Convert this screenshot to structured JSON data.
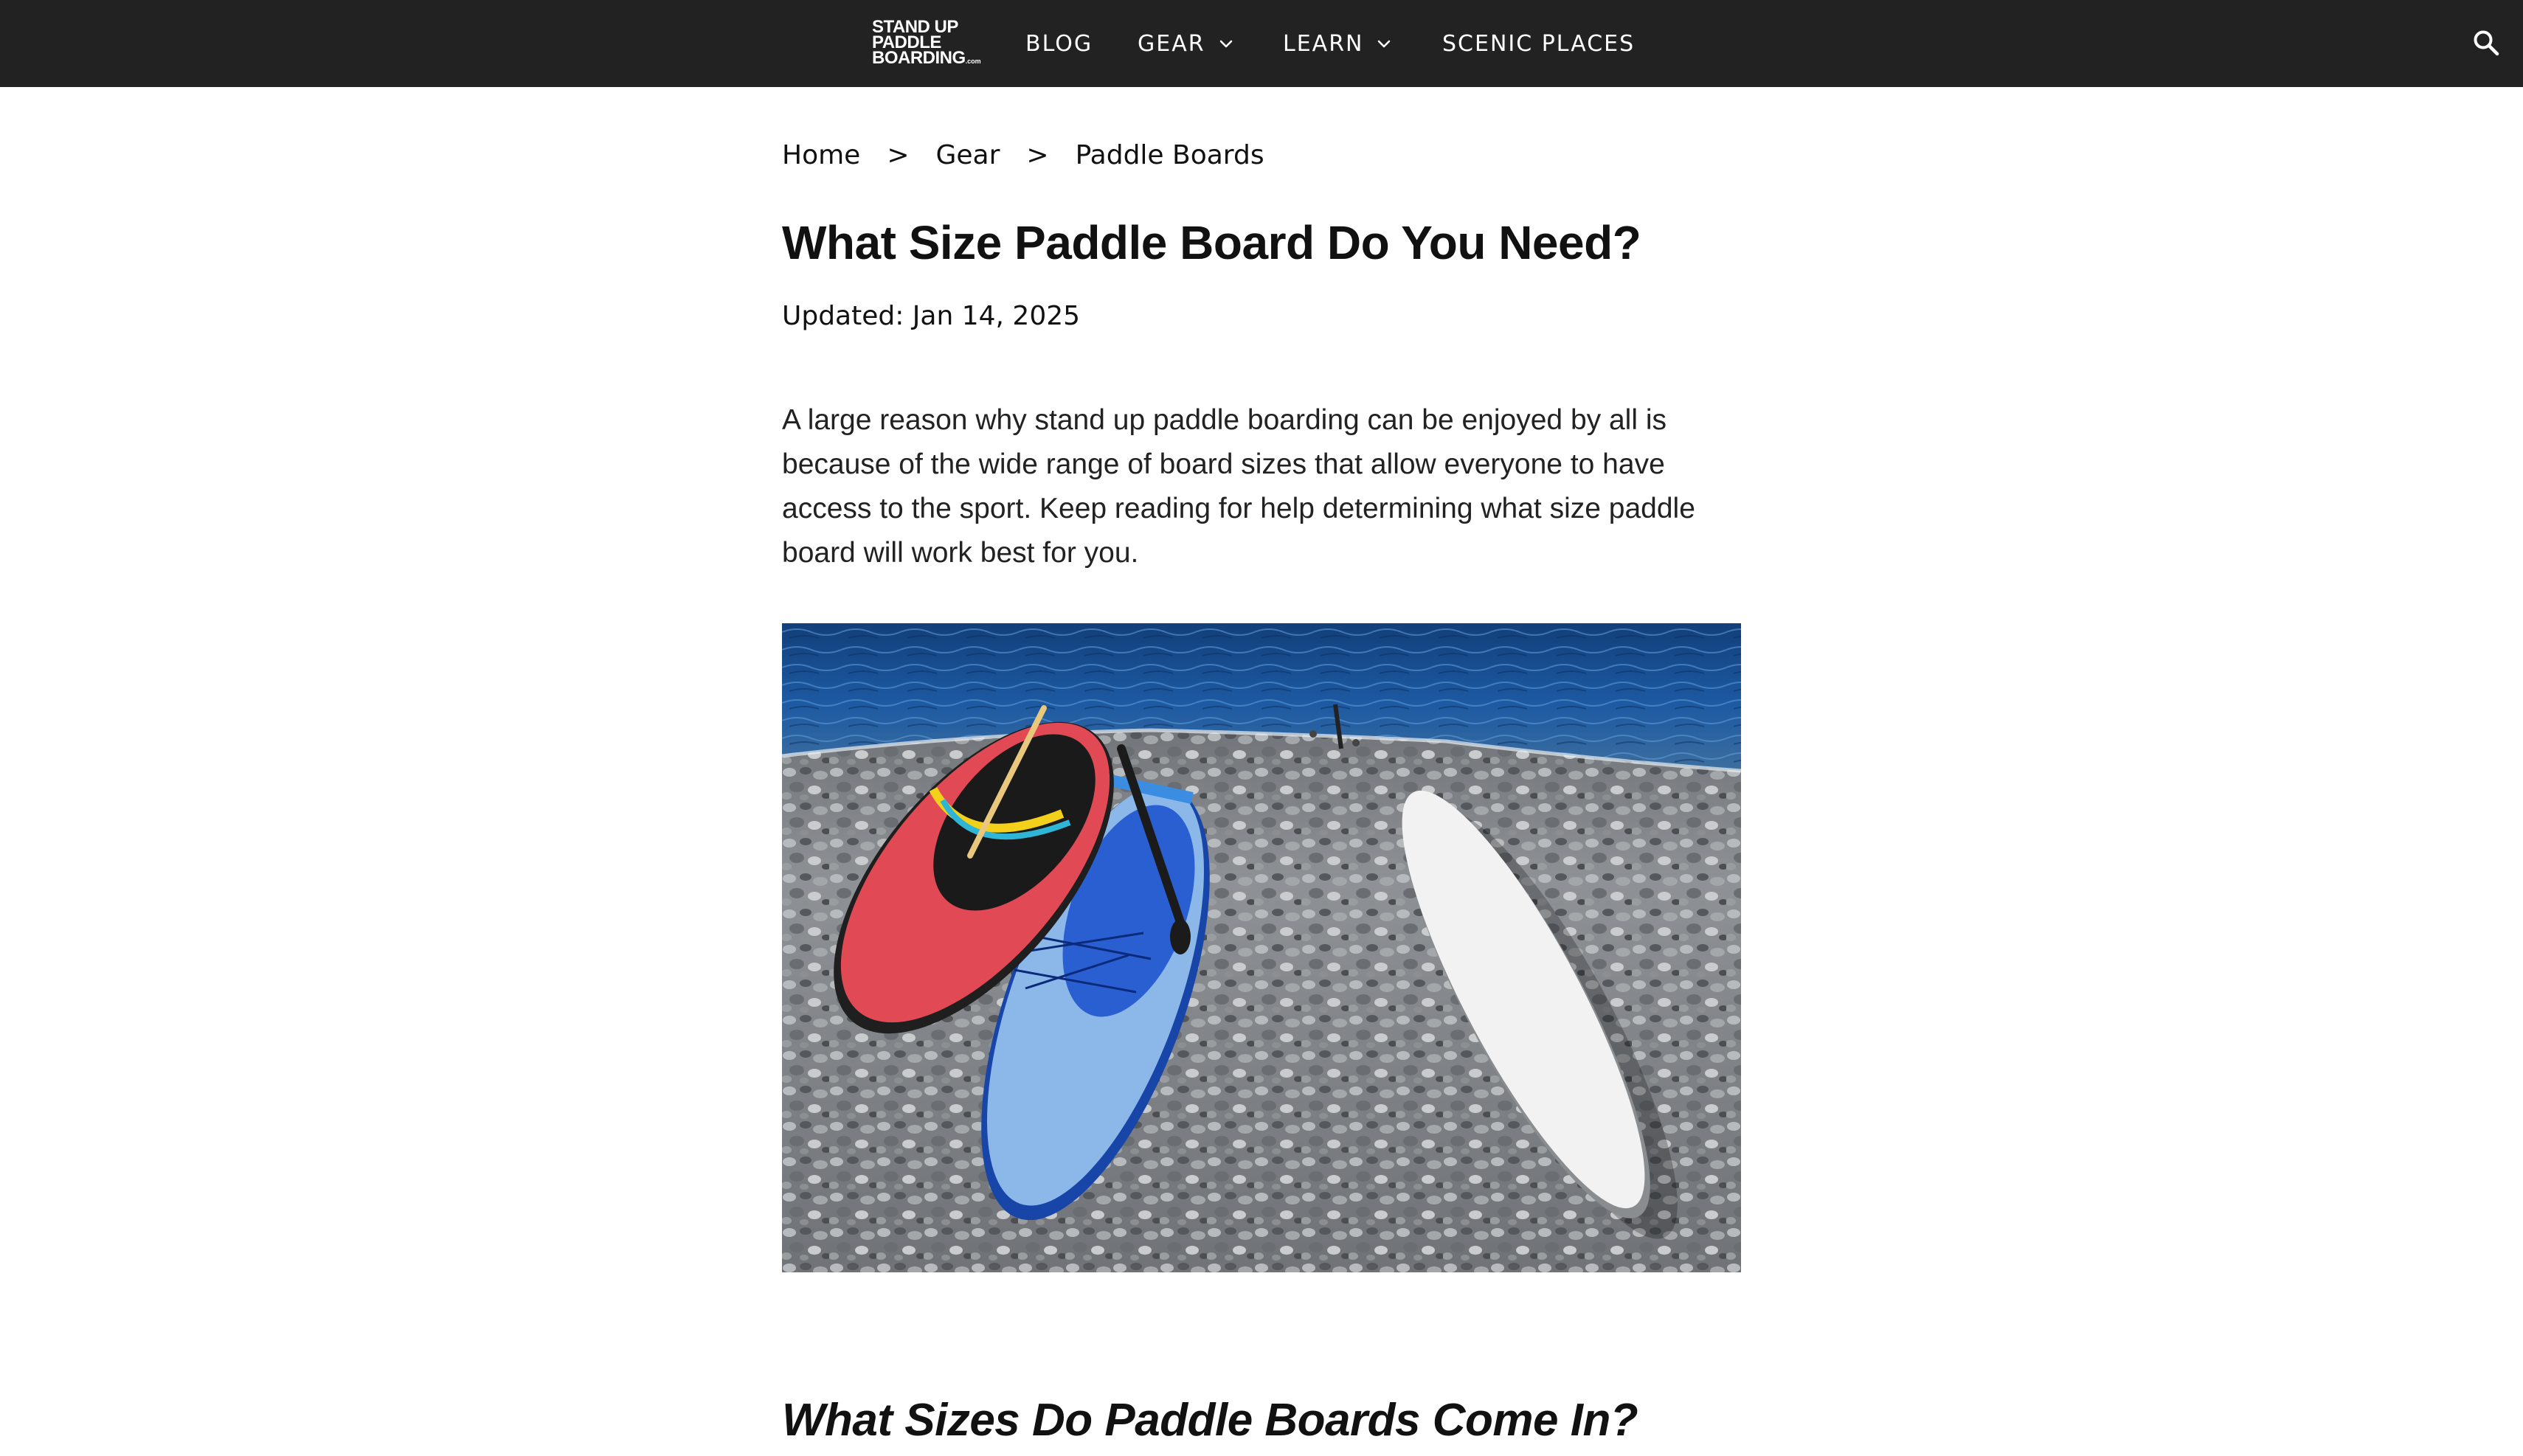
{
  "site": {
    "logo_lines": [
      "STAND UP",
      "PADDLE",
      "BOARDING"
    ],
    "logo_tld": ".com"
  },
  "nav": {
    "items": [
      {
        "label": "BLOG",
        "has_dropdown": false
      },
      {
        "label": "GEAR",
        "has_dropdown": true
      },
      {
        "label": "LEARN",
        "has_dropdown": true
      },
      {
        "label": "SCENIC PLACES",
        "has_dropdown": false
      }
    ],
    "search_icon": "search-icon"
  },
  "breadcrumb": {
    "items": [
      "Home",
      "Gear",
      "Paddle Boards"
    ],
    "separator": ">"
  },
  "article": {
    "title": "What Size Paddle Board Do You Need?",
    "updated": "Updated: Jan 14, 2025",
    "intro": "A large reason why stand up paddle boarding can be enjoyed by all is because of the wide range of board sizes that allow everyone to have access to the sport. Keep reading for help determining what size paddle board will work best for you.",
    "subheading": "What Sizes Do Paddle Boards Come In?"
  },
  "colors": {
    "header_bg": "#222222",
    "header_text": "#ffffff",
    "body_text": "#111111"
  }
}
